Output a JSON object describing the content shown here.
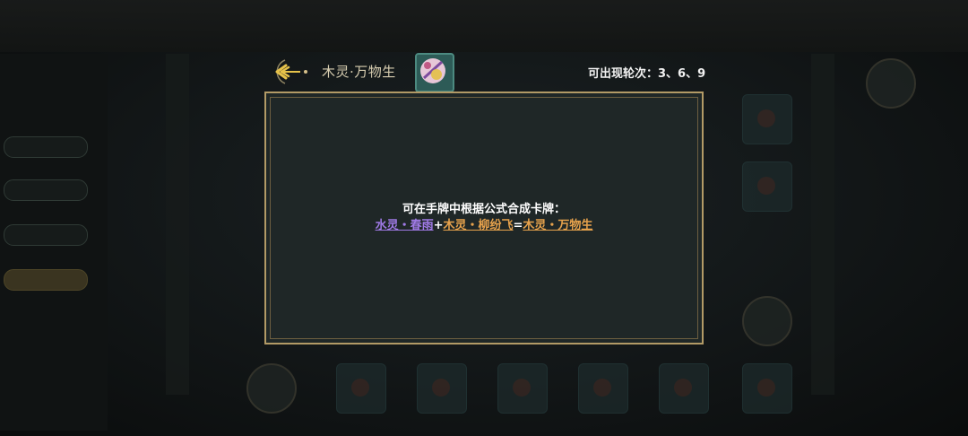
{
  "header": {
    "title": "木灵·万物生",
    "rounds_label": "可出现轮次：3、6、9",
    "back_icon": "back-arrow-icon",
    "card_icon": "card-thumbnail-icon"
  },
  "dialog": {
    "hint": "可在手牌中根据公式合成卡牌：",
    "formula": {
      "ingredient_1": "水灵・春雨",
      "plus": "+",
      "ingredient_2": "木灵・柳纷飞",
      "equals": "=",
      "result": "木灵・万物生"
    }
  },
  "colors": {
    "dialog_bg": "#1f2727",
    "frame_gold": "#b29a66",
    "water_purple": "#a07ae6",
    "wood_orange": "#e7a24c"
  }
}
